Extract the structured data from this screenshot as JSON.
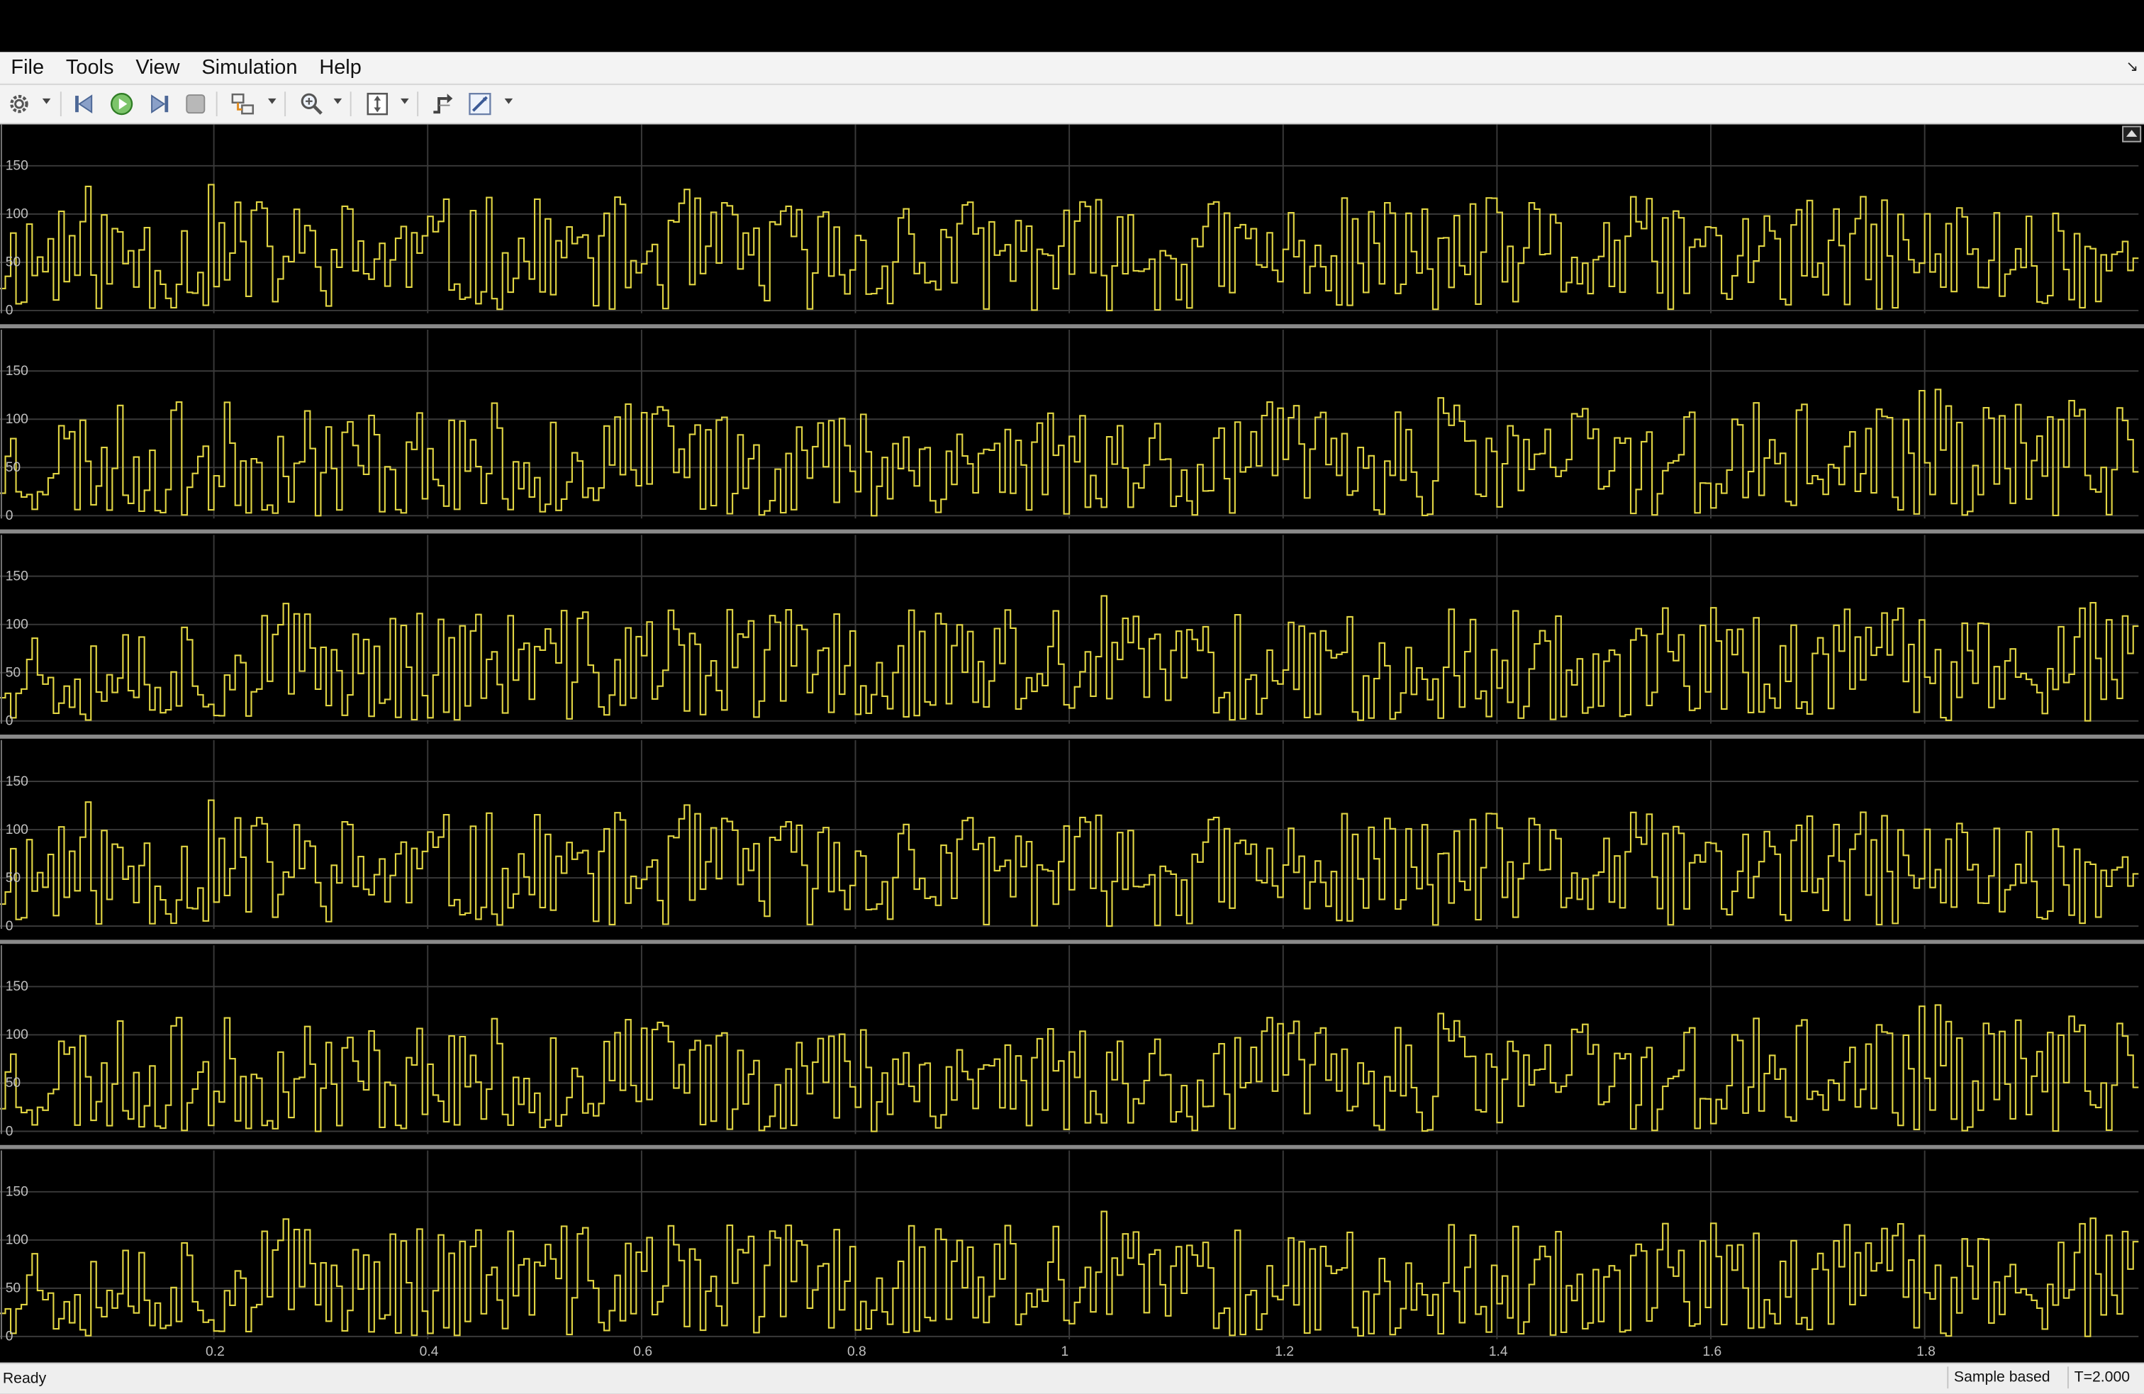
{
  "menu": {
    "items": [
      {
        "id": "file",
        "label": "File"
      },
      {
        "id": "tools",
        "label": "Tools"
      },
      {
        "id": "view",
        "label": "View"
      },
      {
        "id": "simulation",
        "label": "Simulation"
      },
      {
        "id": "help",
        "label": "Help"
      }
    ]
  },
  "toolbar": {
    "buttons": [
      {
        "id": "configuration",
        "icon": "gear-icon",
        "dropdown": true
      },
      {
        "id": "step-back",
        "icon": "step-back-icon",
        "dropdown": false
      },
      {
        "id": "run",
        "icon": "run-icon",
        "dropdown": false
      },
      {
        "id": "step-forward",
        "icon": "step-forward-icon",
        "dropdown": false
      },
      {
        "id": "stop",
        "icon": "stop-icon",
        "dropdown": false
      },
      {
        "id": "highlight",
        "icon": "highlight-icon",
        "dropdown": true
      },
      {
        "id": "zoom",
        "icon": "zoom-icon",
        "dropdown": true
      },
      {
        "id": "scale-axes",
        "icon": "scale-axes-icon",
        "dropdown": true
      },
      {
        "id": "triggers",
        "icon": "triggers-icon",
        "dropdown": false
      },
      {
        "id": "measurements",
        "icon": "measurements-icon",
        "dropdown": true
      }
    ]
  },
  "colors": {
    "signal": "#e1d543",
    "grid": "#3a3a3a",
    "axis_text": "#bfbfbf",
    "background": "#000000",
    "separator": "#8a8a8a"
  },
  "chart_data": {
    "type": "line",
    "panels": 6,
    "xlim": [
      0,
      2
    ],
    "x_ticks": [
      0.2,
      0.4,
      0.6,
      0.8,
      1,
      1.2,
      1.4,
      1.6,
      1.8
    ],
    "x_tick_labels": [
      "0.2",
      "0.4",
      "0.6",
      "0.8",
      "1",
      "1.2",
      "1.4",
      "1.6",
      "1.8"
    ],
    "ylim": [
      0,
      190
    ],
    "y_ticks": [
      0,
      50,
      100,
      150
    ],
    "y_tick_labels": [
      "0",
      "50",
      "100",
      "150"
    ],
    "grid": true,
    "signal_style": "stairs",
    "sample_time": 0.005,
    "seeds": [
      11,
      23,
      37,
      11,
      23,
      37
    ]
  },
  "status": {
    "text": "Ready",
    "mode": "Sample based",
    "time": "T=2.000"
  }
}
